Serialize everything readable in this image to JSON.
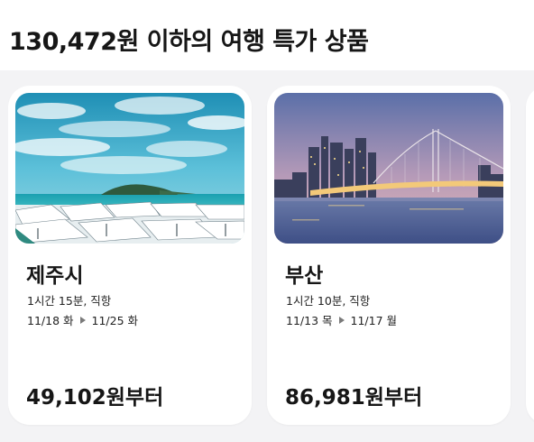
{
  "header": {
    "title": "130,472원 이하의 여행 특가 상품"
  },
  "deals": [
    {
      "city": "제주시",
      "flight_info": "1시간 15분, 직항",
      "depart": "11/18 화",
      "return": "11/25 화",
      "price": "49,102원부터",
      "image": "jeju-beach-photo"
    },
    {
      "city": "부산",
      "flight_info": "1시간 10분, 직항",
      "depart": "11/13 목",
      "return": "11/17 월",
      "price": "86,981원부터",
      "image": "busan-bridge-skyline-photo"
    }
  ],
  "colors": {
    "background": "#f3f3f5",
    "card": "#ffffff",
    "text": "#161616"
  }
}
